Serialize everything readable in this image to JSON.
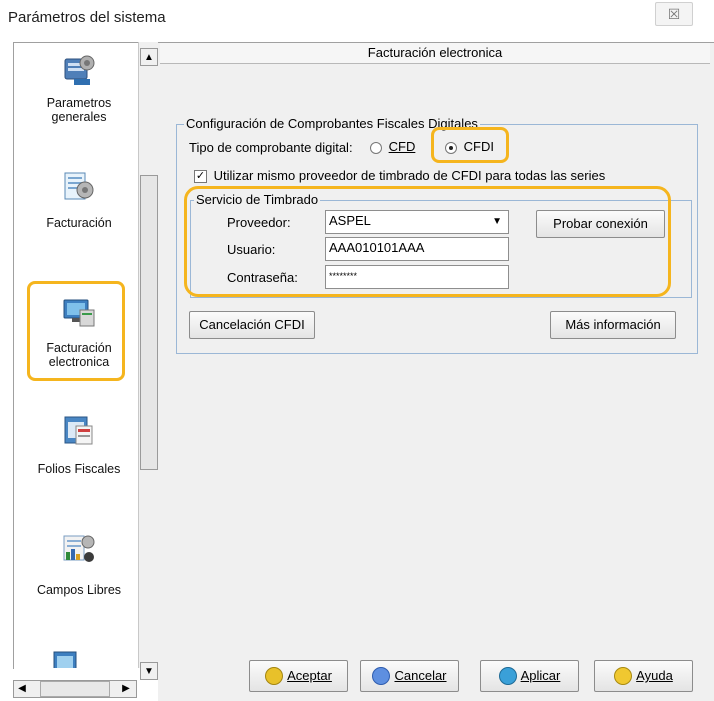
{
  "window": {
    "title": "Parámetros del sistema",
    "close_glyph": "☒"
  },
  "sidebar": {
    "items": [
      {
        "line1": "Parametros",
        "line2": "generales",
        "icon": "gear-pc-icon"
      },
      {
        "line1": "Facturación",
        "line2": "",
        "icon": "invoice-gear-icon"
      },
      {
        "line1": "Facturación",
        "line2": "electronica",
        "icon": "computer-network-icon"
      },
      {
        "line1": "Folios Fiscales",
        "line2": "",
        "icon": "fiscal-folios-icon"
      },
      {
        "line1": "Campos Libres",
        "line2": "",
        "icon": "free-fields-icon"
      }
    ]
  },
  "panel": {
    "header": "Facturación electronica",
    "group_title": "Configuración de Comprobantes Fiscales Digitales",
    "tipo_label": "Tipo de comprobante digital:",
    "radio_cfd": "CFD",
    "radio_cfdi": "CFDI",
    "selected": "CFDI",
    "checkbox_label": "Utilizar mismo proveedor de timbrado de CFDI para  todas las series",
    "checkbox_checked": true,
    "timbrado": {
      "title": "Servicio de Timbrado",
      "proveedor_label": "Proveedor:",
      "proveedor_value": "ASPEL",
      "usuario_label": "Usuario:",
      "usuario_value": "AAA010101AAA",
      "contrasena_label": "Contraseña:",
      "contrasena_value": "********",
      "probar_button": "Probar conexión"
    },
    "cancelacion_button": "Cancelación CFDI",
    "mas_info_button": "Más información"
  },
  "footer": {
    "aceptar": "Aceptar",
    "cancelar": "Cancelar",
    "aplicar": "Aplicar",
    "ayuda": "Ayuda"
  },
  "colors": {
    "highlight": "#f5b51e",
    "frame": "#9bb7d6"
  }
}
